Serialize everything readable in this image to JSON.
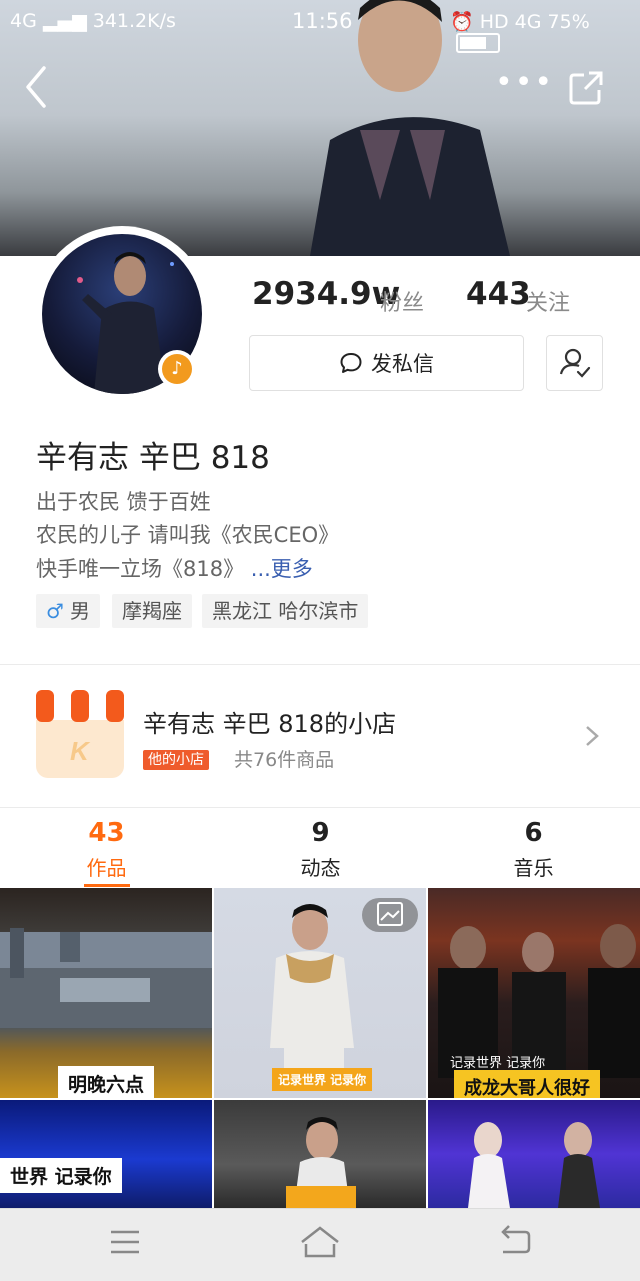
{
  "status_bar": {
    "network": "4G",
    "speed": "341.2K/s",
    "time": "11:56",
    "right": "HD 4G 75%"
  },
  "profile": {
    "fans_count": "2934.9w",
    "fans_label": "粉丝",
    "following_count": "443",
    "following_label": "关注",
    "message_button": "发私信",
    "name": "辛有志 辛巴 818",
    "bio": [
      "出于农民 馈于百姓",
      "农民的儿子 请叫我《农民CEO》",
      "快手唯一立场《818》"
    ],
    "more_link": "...更多",
    "tags": {
      "gender_symbol": "♂",
      "gender": "男",
      "zodiac": "摩羯座",
      "location": "黑龙江 哈尔滨市"
    }
  },
  "shop": {
    "title": "辛有志 辛巴 818的小店",
    "badge": "他的小店",
    "count": "共76件商品"
  },
  "tabs": [
    {
      "count": "43",
      "label": "作品"
    },
    {
      "count": "9",
      "label": "动态"
    },
    {
      "count": "6",
      "label": "音乐"
    }
  ],
  "grid": {
    "c1_caption": "明晚六点",
    "c2_caption": "记录世界 记录你",
    "c3_small": "记录世界 记录你",
    "c3_caption": "成龙大哥人很好",
    "c4_caption": "世界 记录你"
  },
  "colors": {
    "accent": "#ff6a10",
    "link": "#3a5fb0",
    "shop_badge": "#ef5b2c",
    "caption_yellow": "#f6c422"
  }
}
